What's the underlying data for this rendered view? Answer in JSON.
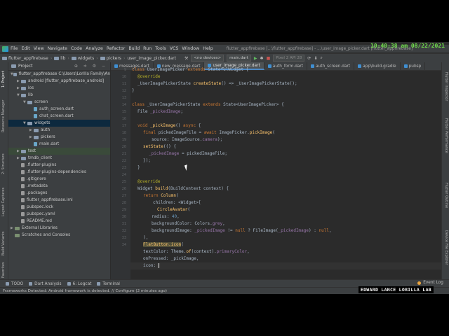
{
  "overlay": {
    "clock": "10:40:38 am 08/22/2021",
    "watermark": "EDWARD LANCE LORILLA LAB"
  },
  "menubar": {
    "items": [
      "File",
      "Edit",
      "View",
      "Navigate",
      "Code",
      "Analyze",
      "Refactor",
      "Build",
      "Run",
      "Tools",
      "VCS",
      "Window",
      "Help"
    ],
    "window_title": "flutter_appfirebase [...\\flutter_appfirebase] - ...\\user_image_picker.dart [flutter_appfirebase]"
  },
  "toolbar": {
    "breadcrumbs": [
      "flutter_appfirebase",
      "lib",
      "widgets",
      "pickers",
      "user_image_picker.dart"
    ],
    "device": "<no devices>",
    "config": "main.dart",
    "emulator": "Pixel 2 API 28"
  },
  "project_panel": {
    "title": "Project",
    "tree": [
      {
        "label": "flutter_appfirebase  C:\\Users\\Lorilla Family\\An",
        "depth": 0,
        "icon": "folder",
        "arrow": "▼"
      },
      {
        "label": "android [flutter_appfirebase_android]",
        "depth": 1,
        "icon": "folder",
        "arrow": "▶"
      },
      {
        "label": "ios",
        "depth": 1,
        "icon": "folder",
        "arrow": "▶"
      },
      {
        "label": "lib",
        "depth": 1,
        "icon": "folder",
        "arrow": "▼"
      },
      {
        "label": "screen",
        "depth": 2,
        "icon": "folder",
        "arrow": "▼"
      },
      {
        "label": "auth_screen.dart",
        "depth": 3,
        "icon": "file",
        "arrow": ""
      },
      {
        "label": "chat_screen.dart",
        "depth": 3,
        "icon": "file",
        "arrow": ""
      },
      {
        "label": "widgets",
        "depth": 2,
        "icon": "folder",
        "arrow": "▼",
        "selected": true
      },
      {
        "label": "auth",
        "depth": 3,
        "icon": "folder",
        "arrow": "▶"
      },
      {
        "label": "pickers",
        "depth": 3,
        "icon": "folder",
        "arrow": "▶"
      },
      {
        "label": "main.dart",
        "depth": 3,
        "icon": "file",
        "arrow": ""
      },
      {
        "label": "test",
        "depth": 1,
        "icon": "folder",
        "arrow": "▶",
        "selected2": true
      },
      {
        "label": "tmdb_client",
        "depth": 1,
        "icon": "folder",
        "arrow": "▶"
      },
      {
        "label": ".flutter-plugins",
        "depth": 1,
        "icon": "gray",
        "arrow": ""
      },
      {
        "label": ".flutter-plugins-dependencies",
        "depth": 1,
        "icon": "gray",
        "arrow": ""
      },
      {
        "label": ".gitignore",
        "depth": 1,
        "icon": "gray",
        "arrow": ""
      },
      {
        "label": ".metadata",
        "depth": 1,
        "icon": "gray",
        "arrow": ""
      },
      {
        "label": ".packages",
        "depth": 1,
        "icon": "gray",
        "arrow": ""
      },
      {
        "label": "flutter_appfirebase.iml",
        "depth": 1,
        "icon": "gray",
        "arrow": ""
      },
      {
        "label": "pubspec.lock",
        "depth": 1,
        "icon": "gray",
        "arrow": ""
      },
      {
        "label": "pubspec.yaml",
        "depth": 1,
        "icon": "gray",
        "arrow": ""
      },
      {
        "label": "README.md",
        "depth": 1,
        "icon": "gray",
        "arrow": ""
      },
      {
        "label": "External Libraries",
        "depth": 0,
        "icon": "lib",
        "arrow": "▶"
      },
      {
        "label": "Scratches and Consoles",
        "depth": 0,
        "icon": "lib",
        "arrow": ""
      }
    ]
  },
  "left_tabs": [
    "1: Project",
    "Resource Manager",
    "2: Structure",
    "Layout Captures",
    "Build Variants",
    "Favorites"
  ],
  "right_tabs": [
    "Flutter Inspector",
    "Flutter Performance",
    "Flutter Outline",
    "Device File Explorer"
  ],
  "editor_tabs": [
    {
      "label": "messages.dart",
      "active": false
    },
    {
      "label": "new_message.dart",
      "active": false
    },
    {
      "label": "user_image_picker.dart",
      "active": true
    },
    {
      "label": "auth_form.dart",
      "active": false
    },
    {
      "label": "auth_screen.dart",
      "active": false
    },
    {
      "label": "app\\build.gradle",
      "active": false
    },
    {
      "label": "pubsp",
      "active": false
    }
  ],
  "line_numbers": [
    "9",
    "10",
    "11",
    "12",
    "13",
    "14",
    "15",
    "16",
    "17",
    "18",
    "19",
    "20",
    "21",
    "22",
    "23",
    "24",
    "25",
    "26",
    "27",
    "28",
    "29",
    "30",
    "31",
    "32",
    "33",
    "34"
  ],
  "code": {
    "l9a": "class ",
    "l9b": "UserImagePicker ",
    "l9c": "extends ",
    "l9d": "StatefulWidget {",
    "l10": "@override",
    "l11a": "_UserImagePickerState ",
    "l11b": "createState",
    "l11c": "() => _UserImagePickerState();",
    "l12": "}",
    "l14a": "class ",
    "l14b": "_UserImagePickerState ",
    "l14c": "extends ",
    "l14d": "State<UserImagePicker> {",
    "l15a": "File ",
    "l15b": "_pickedImage",
    "l17a": "void ",
    "l17b": "_pickImage",
    "l17c": "() ",
    "l17d": "async ",
    "l17e": "{",
    "l18a": "final ",
    "l18b": "pickedImageFile = ",
    "l18c": "await ",
    "l18d": "ImagePicker",
    "l18e": ".",
    "l18f": "pickImage",
    "l18g": "(",
    "l19a": "source: ImageSource.",
    "l19b": "camera",
    "l19c": ");",
    "l20a": "setState",
    "l20b": "(() {",
    "l21a": "_pickedImage",
    "l21b": " = pickedImageFile;",
    "l22": "});",
    "l23": "}",
    "l25": "@override",
    "l26a": "Widget ",
    "l26b": "build",
    "l26c": "(BuildContext context) {",
    "l27a": "return ",
    "l27b": "Column",
    "l27c": "(",
    "l28a": "children: <Widget>[",
    "l29a": "CircleAvatar",
    "l29b": "(",
    "l30a": "radius: ",
    "l30b": "40",
    "l30c": ",",
    "l31a": "backgroundColor: Colors.",
    "l31b": "grey",
    "l31c": ",",
    "l32a": "backgroundImage: ",
    "l32b": "_pickedImage",
    "l32c": " != ",
    "l32d": "null",
    "l32e": " ? FileImage(",
    "l32f": "_pickedImage",
    "l32g": ") : ",
    "l32h": "null",
    "l33": "),",
    "l34a": "FlatButton",
    "l34b": ".",
    "l34c": "icon",
    "l34d": "(",
    "l35a": "textColor: Theme.",
    "l35b": "of",
    "l35c": "(context).",
    "l35d": "primaryColor",
    "l35e": ",",
    "l36a": "onPressed: ",
    "l36b": "_pickImage",
    "l36c": ",",
    "l37": "icon: "
  },
  "bottom_tabs": [
    "TODO",
    "Dart Analysis",
    "6: Logcat",
    "Terminal"
  ],
  "event_log": "Event Log",
  "status": "Frameworks Detected: Android framework is detected. // Configure (2 minutes ago)"
}
